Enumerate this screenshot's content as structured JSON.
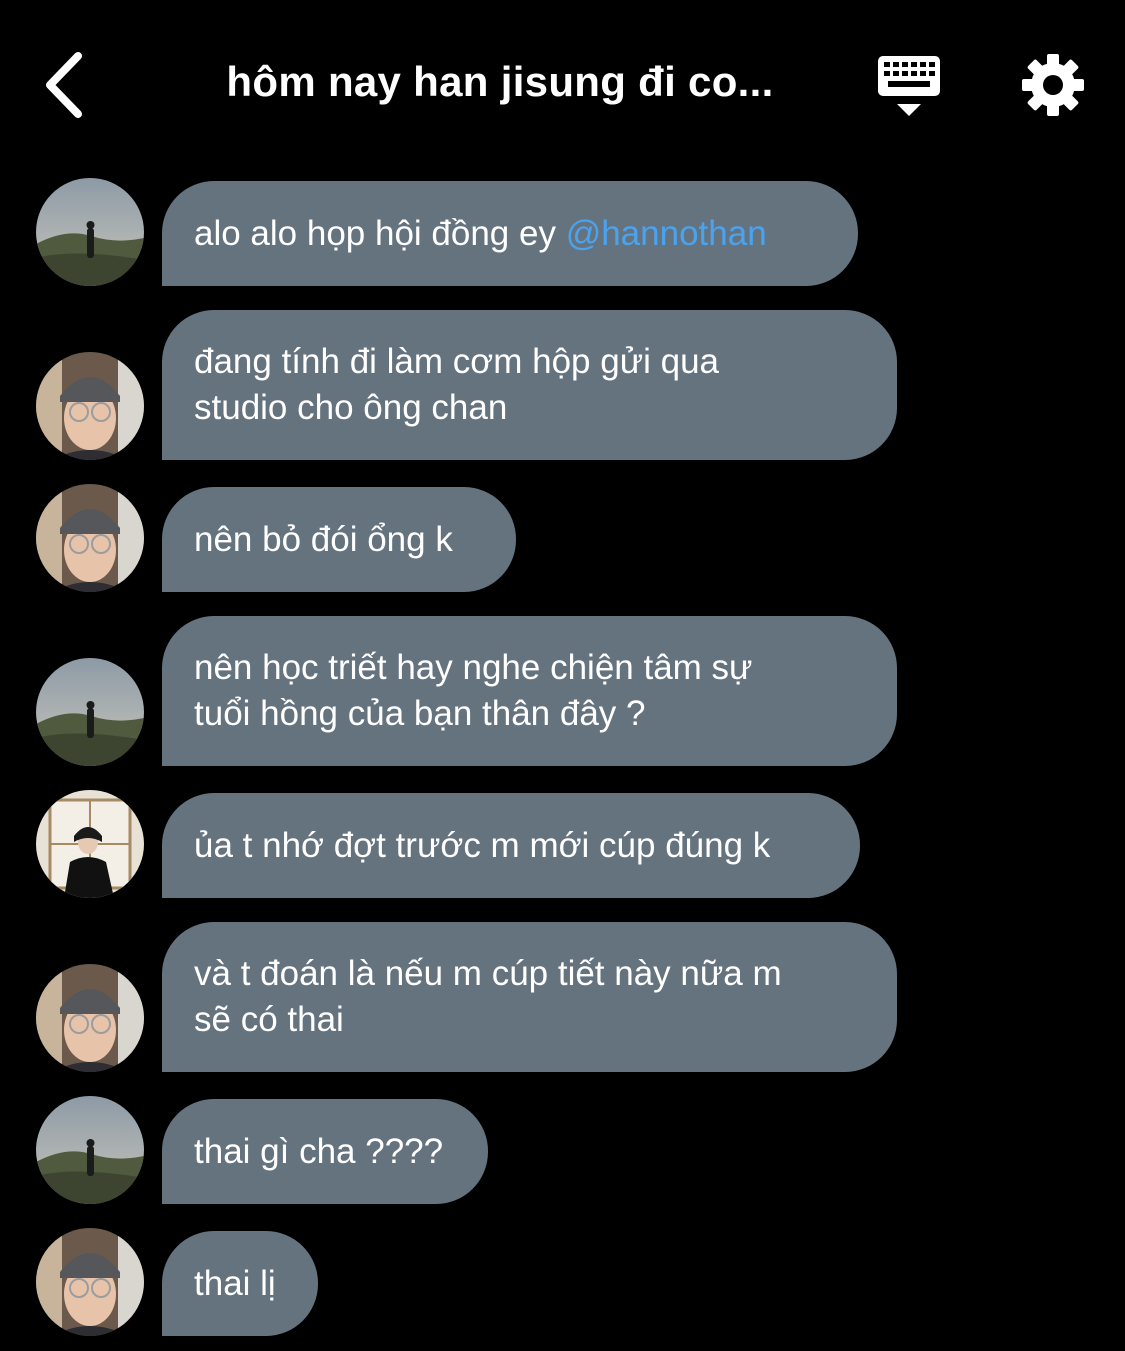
{
  "header": {
    "title": "hôm nay han jisung đi co...",
    "back_icon": "chevron-left-icon",
    "keyboard_icon": "keyboard-icon",
    "settings_icon": "gear-icon"
  },
  "colors": {
    "background": "#000000",
    "bubble": "#65737f",
    "mention": "#4aa3f0",
    "text": "#ffffff"
  },
  "messages": [
    {
      "avatar": "landscape",
      "text": "alo alo họp hội đồng ey ",
      "mention": "@hannothan"
    },
    {
      "avatar": "beanie-glasses",
      "text": "đang tính đi làm cơm hộp gửi qua\nstudio cho ông chan"
    },
    {
      "avatar": "beanie-glasses",
      "text": "nên bỏ đói ổng k"
    },
    {
      "avatar": "landscape",
      "text": "nên học triết hay nghe chiện tâm sự\ntuổi hồng của bạn thân đây ?"
    },
    {
      "avatar": "window-portrait",
      "text": "ủa t nhớ đợt trước m mới cúp đúng k"
    },
    {
      "avatar": "beanie-glasses",
      "text": "và t đoán là nếu m cúp tiết này nữa m\nsẽ có thai"
    },
    {
      "avatar": "landscape",
      "text": "thai gì cha ????"
    },
    {
      "avatar": "beanie-glasses",
      "text": "thai lị"
    }
  ]
}
